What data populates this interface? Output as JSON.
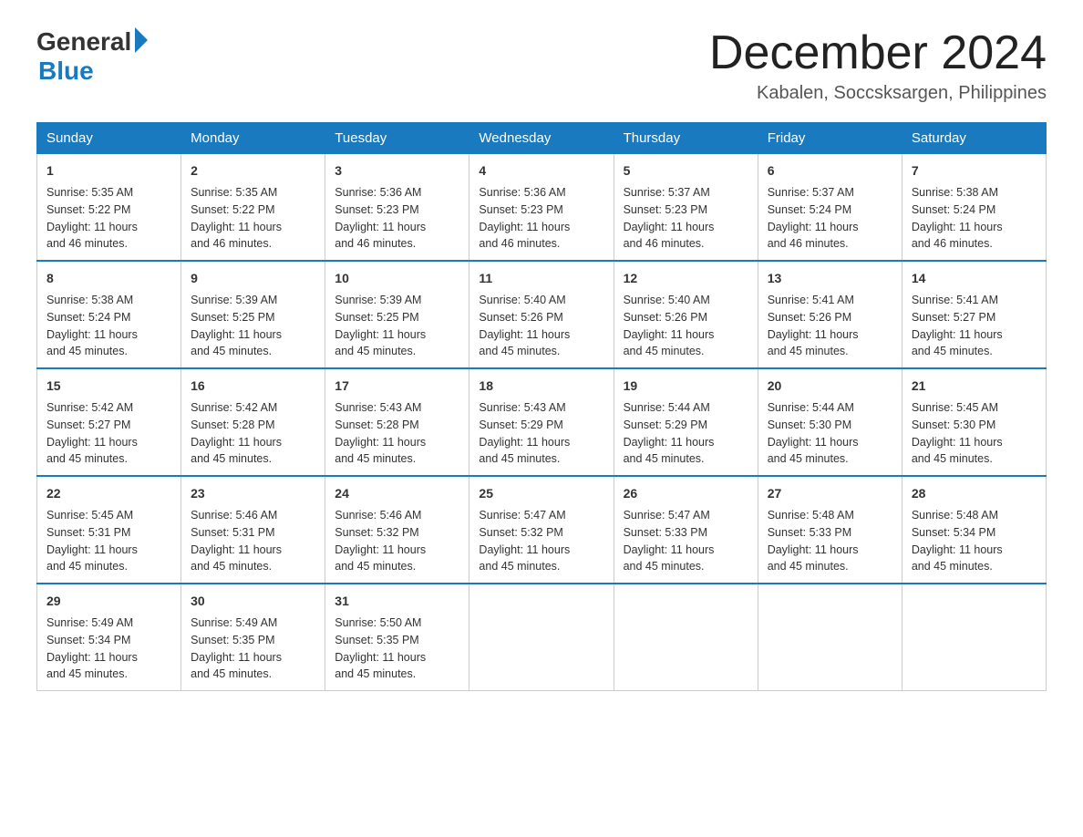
{
  "header": {
    "logo_general": "General",
    "logo_blue": "Blue",
    "month_title": "December 2024",
    "location": "Kabalen, Soccsksargen, Philippines"
  },
  "weekdays": [
    "Sunday",
    "Monday",
    "Tuesday",
    "Wednesday",
    "Thursday",
    "Friday",
    "Saturday"
  ],
  "weeks": [
    [
      {
        "day": "1",
        "sunrise": "5:35 AM",
        "sunset": "5:22 PM",
        "daylight": "11 hours and 46 minutes."
      },
      {
        "day": "2",
        "sunrise": "5:35 AM",
        "sunset": "5:22 PM",
        "daylight": "11 hours and 46 minutes."
      },
      {
        "day": "3",
        "sunrise": "5:36 AM",
        "sunset": "5:23 PM",
        "daylight": "11 hours and 46 minutes."
      },
      {
        "day": "4",
        "sunrise": "5:36 AM",
        "sunset": "5:23 PM",
        "daylight": "11 hours and 46 minutes."
      },
      {
        "day": "5",
        "sunrise": "5:37 AM",
        "sunset": "5:23 PM",
        "daylight": "11 hours and 46 minutes."
      },
      {
        "day": "6",
        "sunrise": "5:37 AM",
        "sunset": "5:24 PM",
        "daylight": "11 hours and 46 minutes."
      },
      {
        "day": "7",
        "sunrise": "5:38 AM",
        "sunset": "5:24 PM",
        "daylight": "11 hours and 46 minutes."
      }
    ],
    [
      {
        "day": "8",
        "sunrise": "5:38 AM",
        "sunset": "5:24 PM",
        "daylight": "11 hours and 45 minutes."
      },
      {
        "day": "9",
        "sunrise": "5:39 AM",
        "sunset": "5:25 PM",
        "daylight": "11 hours and 45 minutes."
      },
      {
        "day": "10",
        "sunrise": "5:39 AM",
        "sunset": "5:25 PM",
        "daylight": "11 hours and 45 minutes."
      },
      {
        "day": "11",
        "sunrise": "5:40 AM",
        "sunset": "5:26 PM",
        "daylight": "11 hours and 45 minutes."
      },
      {
        "day": "12",
        "sunrise": "5:40 AM",
        "sunset": "5:26 PM",
        "daylight": "11 hours and 45 minutes."
      },
      {
        "day": "13",
        "sunrise": "5:41 AM",
        "sunset": "5:26 PM",
        "daylight": "11 hours and 45 minutes."
      },
      {
        "day": "14",
        "sunrise": "5:41 AM",
        "sunset": "5:27 PM",
        "daylight": "11 hours and 45 minutes."
      }
    ],
    [
      {
        "day": "15",
        "sunrise": "5:42 AM",
        "sunset": "5:27 PM",
        "daylight": "11 hours and 45 minutes."
      },
      {
        "day": "16",
        "sunrise": "5:42 AM",
        "sunset": "5:28 PM",
        "daylight": "11 hours and 45 minutes."
      },
      {
        "day": "17",
        "sunrise": "5:43 AM",
        "sunset": "5:28 PM",
        "daylight": "11 hours and 45 minutes."
      },
      {
        "day": "18",
        "sunrise": "5:43 AM",
        "sunset": "5:29 PM",
        "daylight": "11 hours and 45 minutes."
      },
      {
        "day": "19",
        "sunrise": "5:44 AM",
        "sunset": "5:29 PM",
        "daylight": "11 hours and 45 minutes."
      },
      {
        "day": "20",
        "sunrise": "5:44 AM",
        "sunset": "5:30 PM",
        "daylight": "11 hours and 45 minutes."
      },
      {
        "day": "21",
        "sunrise": "5:45 AM",
        "sunset": "5:30 PM",
        "daylight": "11 hours and 45 minutes."
      }
    ],
    [
      {
        "day": "22",
        "sunrise": "5:45 AM",
        "sunset": "5:31 PM",
        "daylight": "11 hours and 45 minutes."
      },
      {
        "day": "23",
        "sunrise": "5:46 AM",
        "sunset": "5:31 PM",
        "daylight": "11 hours and 45 minutes."
      },
      {
        "day": "24",
        "sunrise": "5:46 AM",
        "sunset": "5:32 PM",
        "daylight": "11 hours and 45 minutes."
      },
      {
        "day": "25",
        "sunrise": "5:47 AM",
        "sunset": "5:32 PM",
        "daylight": "11 hours and 45 minutes."
      },
      {
        "day": "26",
        "sunrise": "5:47 AM",
        "sunset": "5:33 PM",
        "daylight": "11 hours and 45 minutes."
      },
      {
        "day": "27",
        "sunrise": "5:48 AM",
        "sunset": "5:33 PM",
        "daylight": "11 hours and 45 minutes."
      },
      {
        "day": "28",
        "sunrise": "5:48 AM",
        "sunset": "5:34 PM",
        "daylight": "11 hours and 45 minutes."
      }
    ],
    [
      {
        "day": "29",
        "sunrise": "5:49 AM",
        "sunset": "5:34 PM",
        "daylight": "11 hours and 45 minutes."
      },
      {
        "day": "30",
        "sunrise": "5:49 AM",
        "sunset": "5:35 PM",
        "daylight": "11 hours and 45 minutes."
      },
      {
        "day": "31",
        "sunrise": "5:50 AM",
        "sunset": "5:35 PM",
        "daylight": "11 hours and 45 minutes."
      },
      null,
      null,
      null,
      null
    ]
  ],
  "labels": {
    "sunrise": "Sunrise:",
    "sunset": "Sunset:",
    "daylight": "Daylight:"
  },
  "colors": {
    "header_bg": "#1a7abf",
    "border_accent": "#1a7abf"
  }
}
